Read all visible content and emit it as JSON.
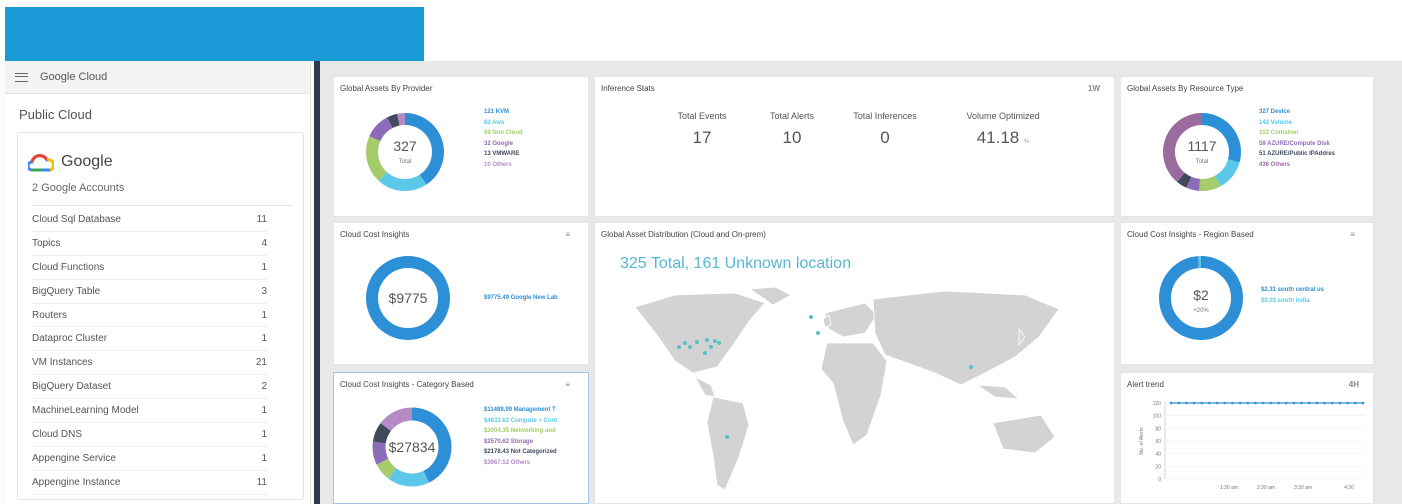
{
  "colors": {
    "banner": "#1a9ad6",
    "accent": "#2d8fd5",
    "divider": "#2b3b4e"
  },
  "sidebar": {
    "provider": "Google Cloud",
    "section_title": "Public Cloud",
    "brand": "Google",
    "brand_icon": "google-cloud-icon",
    "account_count": "2 Google Accounts",
    "resources": [
      {
        "name": "Cloud Sql Database",
        "count": "11"
      },
      {
        "name": "Topics",
        "count": "4"
      },
      {
        "name": "Cloud Functions",
        "count": "1"
      },
      {
        "name": "BigQuery Table",
        "count": "3"
      },
      {
        "name": "Routers",
        "count": "1"
      },
      {
        "name": "Dataproc Cluster",
        "count": "1"
      },
      {
        "name": "VM Instances",
        "count": "21"
      },
      {
        "name": "BigQuery Dataset",
        "count": "2"
      },
      {
        "name": "MachineLearning Model",
        "count": "1"
      },
      {
        "name": "Cloud DNS",
        "count": "1"
      },
      {
        "name": "Appengine Service",
        "count": "1"
      },
      {
        "name": "Appengine Instance",
        "count": "11"
      }
    ]
  },
  "widgets": {
    "assets_by_provider": {
      "title": "Global Assets By Provider",
      "center_value": "327",
      "center_label": "Total",
      "legend": [
        {
          "label": "121 KVM",
          "color": "#2d8fd5",
          "value": 121
        },
        {
          "label": "62 Aws",
          "color": "#5bc8e8",
          "value": 62
        },
        {
          "label": "59 Non Cloud",
          "color": "#a5cc6b",
          "value": 59
        },
        {
          "label": "32 Google",
          "color": "#8c6bb8",
          "value": 32
        },
        {
          "label": "13 VMWARE",
          "color": "#404a5c",
          "value": 13
        },
        {
          "label": "10 Others",
          "color": "#b58ac4",
          "value": 10
        }
      ]
    },
    "inference_stats": {
      "title": "Inference Stats",
      "period": "1W",
      "stats": [
        {
          "label": "Total Events",
          "value": "17",
          "unit": ""
        },
        {
          "label": "Total Alerts",
          "value": "10",
          "unit": ""
        },
        {
          "label": "Total Inferences",
          "value": "0",
          "unit": ""
        },
        {
          "label": "Volume Optimized",
          "value": "41.18",
          "unit": "%"
        }
      ]
    },
    "assets_by_resource_type": {
      "title": "Global Assets By Resource Type",
      "center_value": "1117",
      "center_label": "Total",
      "legend": [
        {
          "label": "327 Device",
          "color": "#2d8fd5",
          "value": 327
        },
        {
          "label": "142 Volume",
          "color": "#5bc8e8",
          "value": 142
        },
        {
          "label": "102 Container",
          "color": "#a5cc6b",
          "value": 102
        },
        {
          "label": "59 AZURE/Compute Disk",
          "color": "#8c6bb8",
          "value": 59
        },
        {
          "label": "51 AZURE/Public IPAddres",
          "color": "#404a5c",
          "value": 51
        },
        {
          "label": "436 Others",
          "color": "#9b6b9e",
          "value": 436
        }
      ]
    },
    "cost_insights": {
      "title": "Cloud Cost Insights",
      "action_icon": "menu-icon",
      "center_value": "$9775",
      "legend": [
        {
          "label": "$9775.49 Google New Lab",
          "color": "#2d8fd5",
          "value": 9775.49
        }
      ]
    },
    "asset_distribution": {
      "title": "Global Asset Distribution (Cloud and On-prem)",
      "headline": "325 Total, 161 Unknown location",
      "marker_color": "#5bc0c5"
    },
    "cost_region": {
      "title": "Cloud Cost Insights - Region Based",
      "action_icon": "menu-icon",
      "center_value": "$2",
      "center_sub": "+20%",
      "legend": [
        {
          "label": "$2.31 south central us",
          "color": "#2d8fd5",
          "value": 2.31
        },
        {
          "label": "$0.03 south india",
          "color": "#5bc8e8",
          "value": 0.03
        }
      ]
    },
    "cost_category": {
      "title": "Cloud Cost Insights - Category Based",
      "action_icon": "menu-icon",
      "center_value": "$27834",
      "legend": [
        {
          "label": "$11489.99 Management T",
          "color": "#2d8fd5",
          "value": 11489.99
        },
        {
          "label": "$4633.62 Compute + Cont",
          "color": "#5bc8e8",
          "value": 4633.62
        },
        {
          "label": "$2004.35 Networking and",
          "color": "#a5cc6b",
          "value": 2004.35
        },
        {
          "label": "$2570.62 Storage",
          "color": "#8c6bb8",
          "value": 2570.62
        },
        {
          "label": "$2178.43 Not Categorized",
          "color": "#404a5c",
          "value": 2178.43
        },
        {
          "label": "$3967.52 Others",
          "color": "#b58ac4",
          "value": 3967.52
        }
      ]
    },
    "alert_trend": {
      "title": "Alert trend",
      "period": "4H"
    }
  },
  "chart_data": [
    {
      "type": "line",
      "title": "Alert trend",
      "ylabel": "No. of Alerts",
      "ylim": [
        0,
        120
      ],
      "yticks": [
        "120",
        "100",
        "80",
        "60",
        "40",
        "20",
        "0"
      ],
      "xticks": [
        "1:30 am",
        "2:30 am",
        "3:30 am",
        "4:30"
      ],
      "series": [
        {
          "values": [
            120,
            120,
            120,
            120,
            120,
            120,
            120,
            120,
            120,
            120,
            120,
            120,
            120,
            120,
            120,
            120,
            120,
            120,
            120,
            120,
            120,
            120,
            120,
            120,
            120,
            120
          ]
        }
      ]
    }
  ]
}
